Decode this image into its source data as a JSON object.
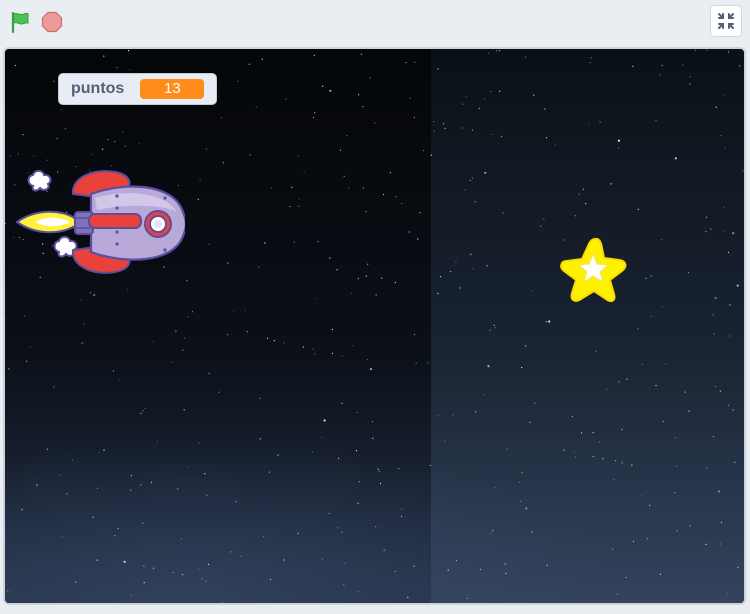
{
  "toolbar": {
    "green_flag_icon": "green-flag-icon",
    "stop_icon": "stop-icon",
    "fullscreen_icon": "exit-fullscreen-icon",
    "flag_color": "#4cbf56",
    "stop_color": "#ec5959"
  },
  "stage": {
    "background": "space-starfield",
    "variable_monitor": {
      "label": "puntos",
      "value": "13",
      "value_color": "#ff8c1a"
    },
    "sprites": [
      {
        "name": "rocketship"
      },
      {
        "name": "star"
      }
    ]
  }
}
